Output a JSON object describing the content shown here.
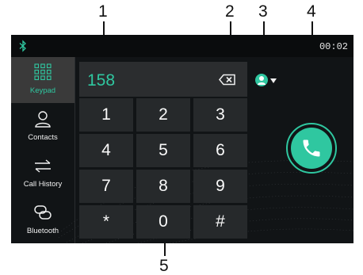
{
  "callouts": [
    "1",
    "2",
    "3",
    "4",
    "5"
  ],
  "status_bar": {
    "time": "00:02"
  },
  "sidebar": {
    "items": [
      {
        "label": "Keypad",
        "icon": "keypad-icon",
        "active": true
      },
      {
        "label": "Contacts",
        "icon": "person-icon",
        "active": false
      },
      {
        "label": "Call History",
        "icon": "arrows-icon",
        "active": false
      },
      {
        "label": "Bluetooth",
        "icon": "link-icon",
        "active": false
      }
    ]
  },
  "dialer": {
    "number": "158",
    "keys": [
      "1",
      "2",
      "3",
      "4",
      "5",
      "6",
      "7",
      "8",
      "9",
      "*",
      "0",
      "#"
    ]
  },
  "colors": {
    "accent": "#2fc7a0",
    "background": "#111416",
    "key": "#26292b",
    "active_tab": "#3a3a3a"
  }
}
